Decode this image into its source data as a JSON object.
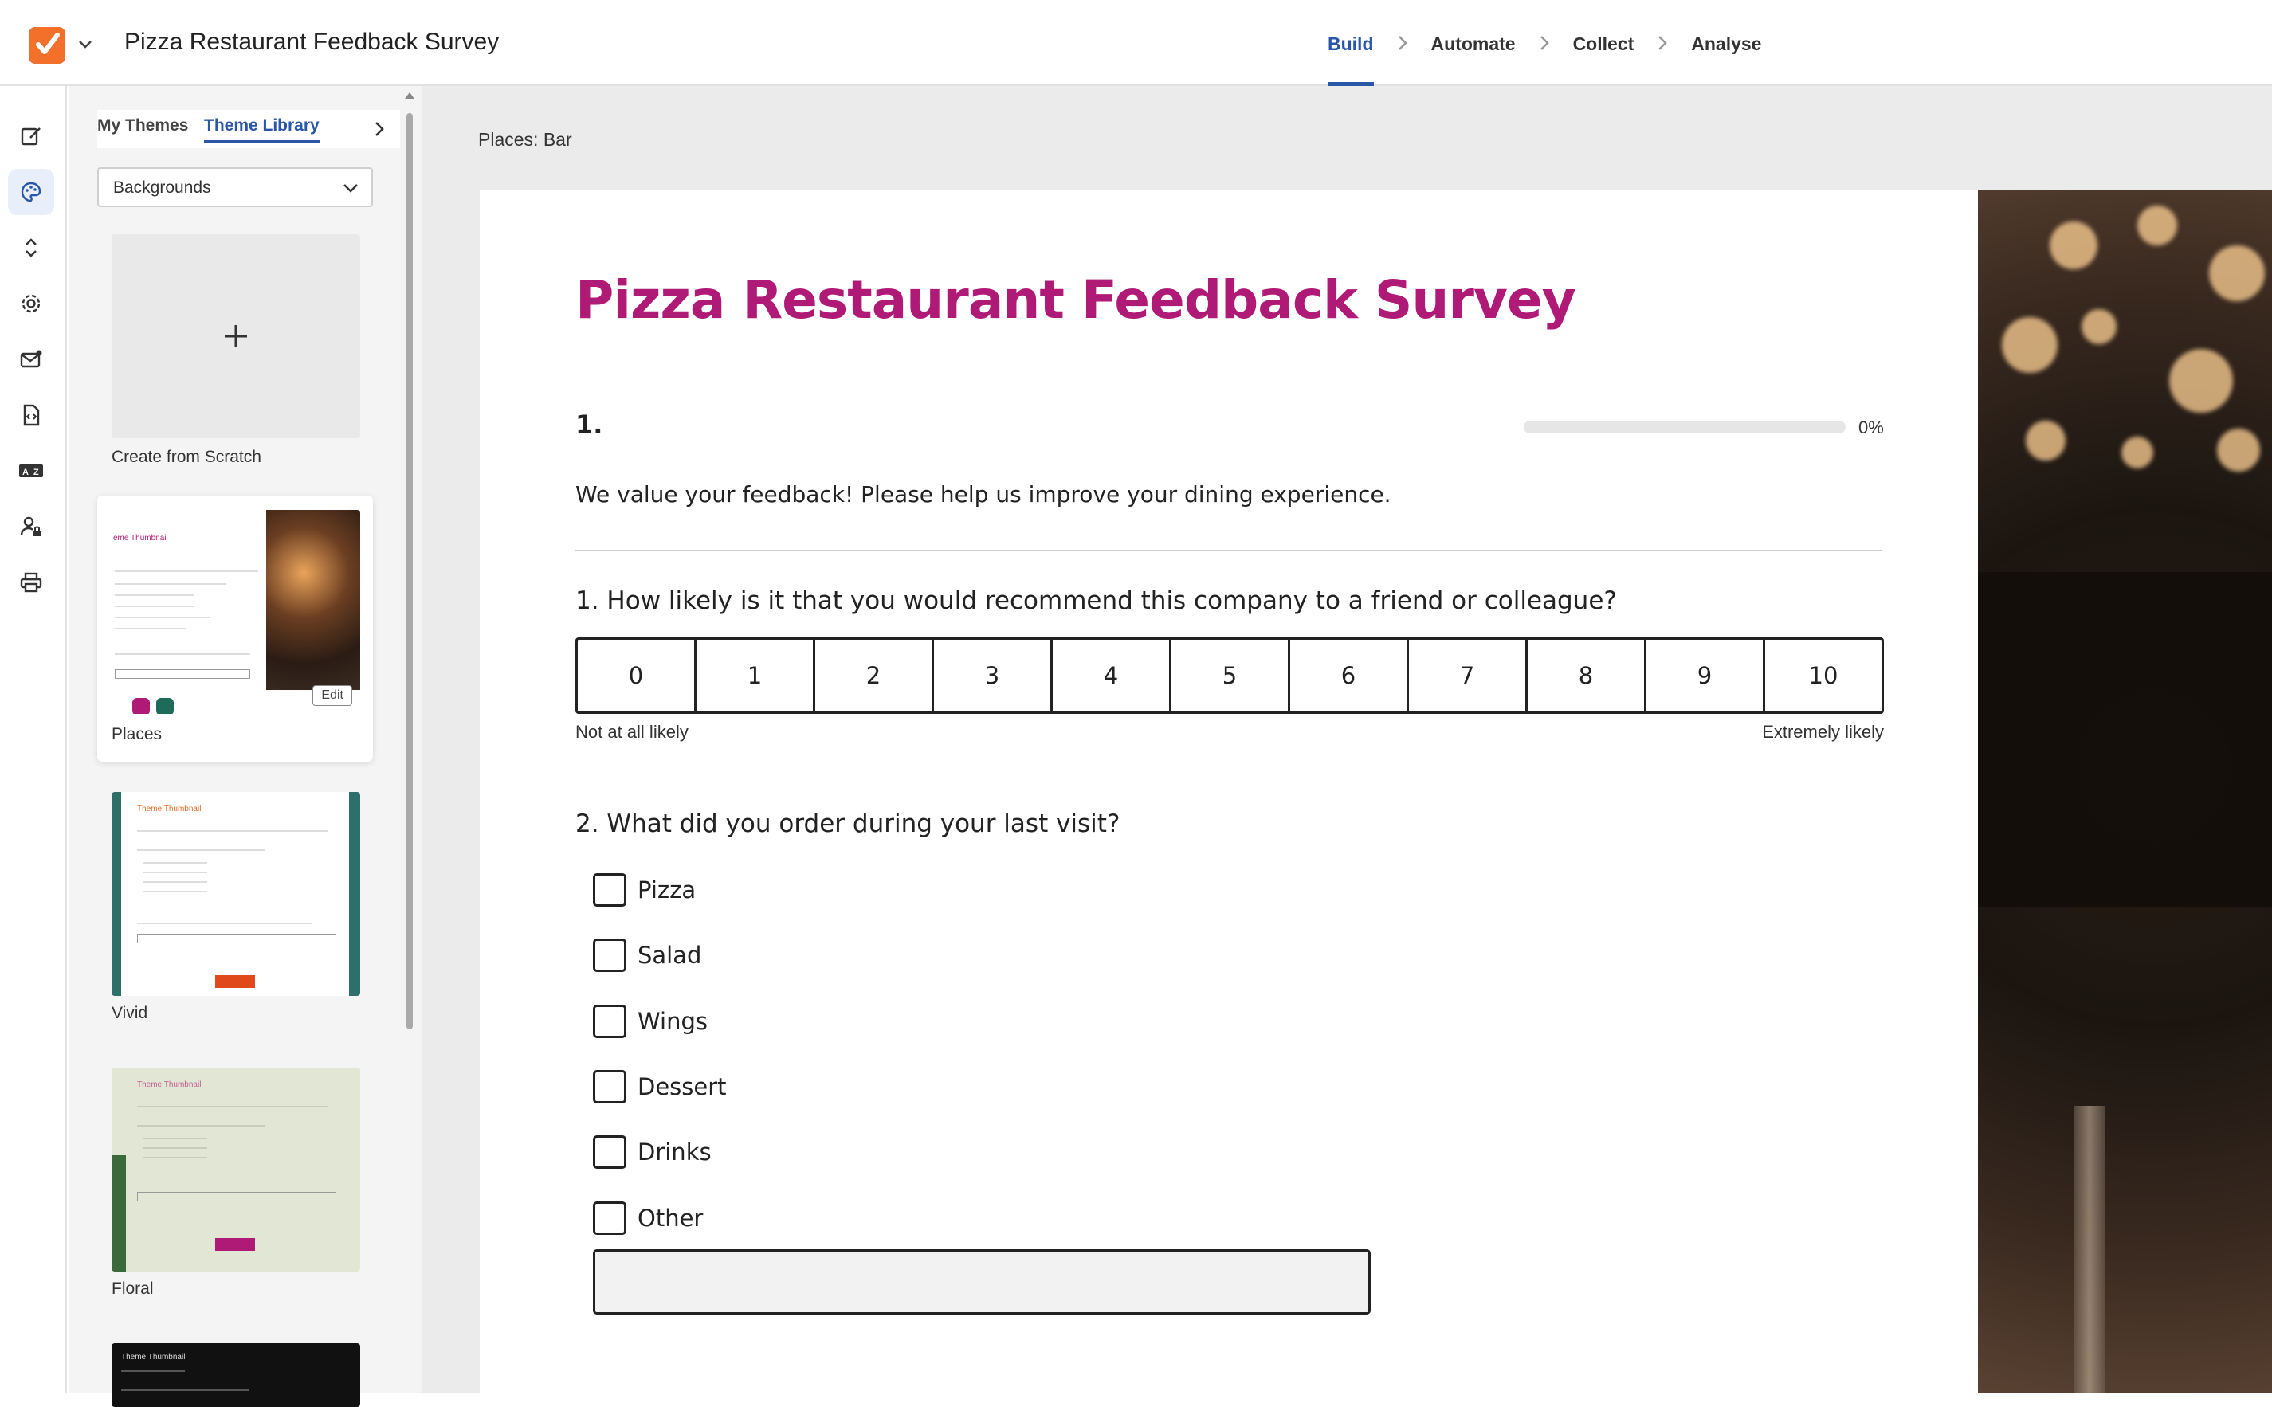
{
  "header": {
    "app_title": "Pizza Restaurant Feedback Survey",
    "steps": [
      "Build",
      "Automate",
      "Collect",
      "Analyse"
    ],
    "active_step": "Build",
    "accent_color": "#2a56a8",
    "logo_color": "#f2702a"
  },
  "rail": {
    "icons": [
      "edit-icon",
      "palette-icon",
      "expand-collapse-icon",
      "gear-icon",
      "mail-icon",
      "code-file-icon",
      "translate-icon",
      "user-lock-icon",
      "print-icon"
    ],
    "active": "palette-icon"
  },
  "theme_panel": {
    "tabs": [
      "My Themes",
      "Theme Library"
    ],
    "active_tab": "Theme Library",
    "dropdown_value": "Backgrounds",
    "create_label": "Create from Scratch",
    "edit_label": "Edit",
    "themes": [
      {
        "name": "Places",
        "selected": true,
        "thumb_title": "eme Thumbnail"
      },
      {
        "name": "Vivid",
        "selected": false,
        "thumb_title": "Theme Thumbnail"
      },
      {
        "name": "Floral",
        "selected": false,
        "thumb_title": "Theme Thumbnail"
      },
      {
        "name": "",
        "selected": false,
        "thumb_title": "Theme Thumbnail"
      }
    ]
  },
  "canvas": {
    "theme_label": "Places: Bar"
  },
  "survey": {
    "title": "Pizza Restaurant Feedback Survey",
    "title_color": "#b01a77",
    "page_number": "1.",
    "progress_fraction": 0,
    "progress_label": "0%",
    "intro": "We value your feedback! Please help us improve your dining experience.",
    "q1": {
      "text": "1. How likely is it that you would recommend this company to a friend or colleague?",
      "scale": [
        "0",
        "1",
        "2",
        "3",
        "4",
        "5",
        "6",
        "7",
        "8",
        "9",
        "10"
      ],
      "low_label": "Not at all likely",
      "high_label": "Extremely likely"
    },
    "q2": {
      "text": "2. What did you order during your last visit?",
      "options": [
        "Pizza",
        "Salad",
        "Wings",
        "Dessert",
        "Drinks",
        "Other"
      ],
      "other_value": ""
    }
  }
}
